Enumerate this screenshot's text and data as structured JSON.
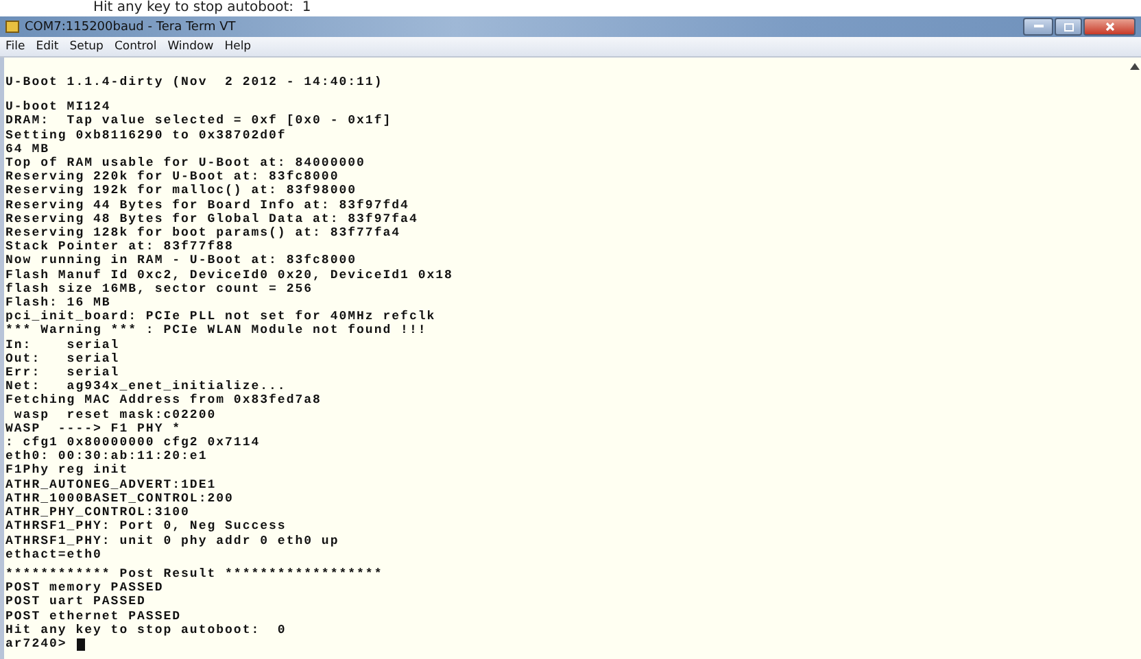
{
  "caption": "Hit any key to stop autoboot:  1",
  "window": {
    "title": "COM7:115200baud - Tera Term VT"
  },
  "menu": [
    "File",
    "Edit",
    "Setup",
    "Control",
    "Window",
    "Help"
  ],
  "terminal": {
    "blocks": [
      [
        "U-Boot 1.1.4-dirty (Nov  2 2012 - 14:40:11)"
      ],
      [
        "U-boot MI124",
        "DRAM:  Tap value selected = 0xf [0x0 - 0x1f]",
        "Setting 0xb8116290 to 0x38702d0f",
        "64 MB",
        "Top of RAM usable for U-Boot at: 84000000",
        "Reserving 220k for U-Boot at: 83fc8000",
        "Reserving 192k for malloc() at: 83f98000",
        "Reserving 44 Bytes for Board Info at: 83f97fd4",
        "Reserving 48 Bytes for Global Data at: 83f97fa4",
        "Reserving 128k for boot params() at: 83f77fa4",
        "Stack Pointer at: 83f77f88",
        "Now running in RAM - U-Boot at: 83fc8000",
        "Flash Manuf Id 0xc2, DeviceId0 0x20, DeviceId1 0x18",
        "flash size 16MB, sector count = 256",
        "Flash: 16 MB",
        "pci_init_board: PCIe PLL not set for 40MHz refclk",
        "*** Warning *** : PCIe WLAN Module not found !!!",
        "In:    serial",
        "Out:   serial",
        "Err:   serial",
        "Net:   ag934x_enet_initialize...",
        "Fetching MAC Address from 0x83fed7a8",
        " wasp  reset mask:c02200",
        "WASP  ----> F1 PHY *",
        ": cfg1 0x80000000 cfg2 0x7114",
        "eth0: 00:30:ab:11:20:e1",
        "F1Phy reg init",
        "ATHR_AUTONEG_ADVERT:1DE1",
        "ATHR_1000BASET_CONTROL:200",
        "ATHR_PHY_CONTROL:3100",
        "ATHRSF1_PHY: Port 0, Neg Success",
        "ATHRSF1_PHY: unit 0 phy addr 0 eth0 up",
        "ethact=eth0"
      ],
      [
        "************ Post Result ******************",
        "POST memory PASSED",
        "POST uart PASSED",
        "POST ethernet PASSED",
        "Hit any key to stop autoboot:  0"
      ]
    ],
    "prompt": "ar7240>"
  }
}
